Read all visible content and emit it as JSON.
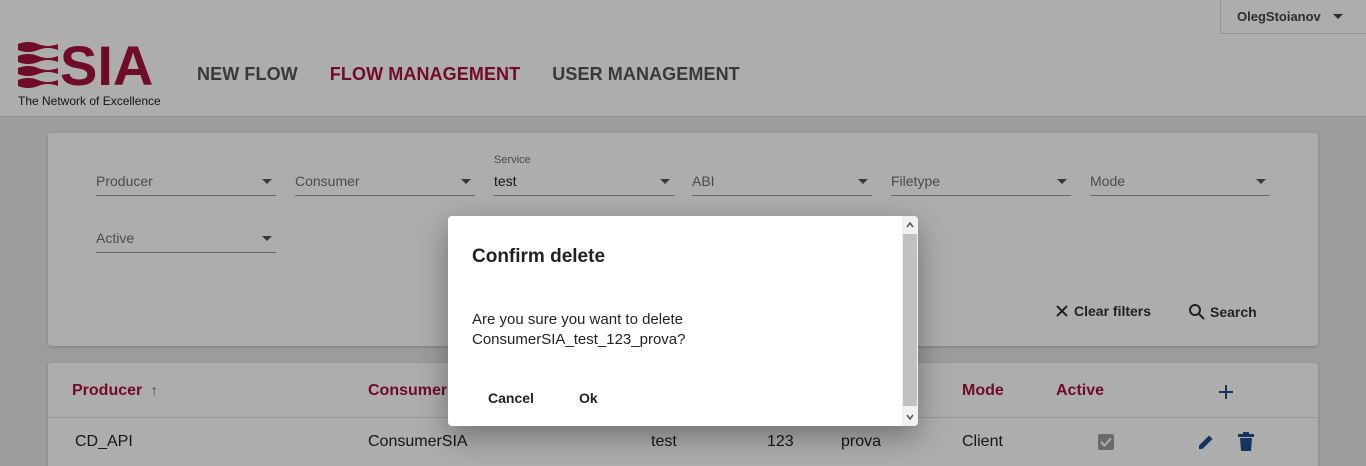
{
  "header": {
    "user_name": "OlegStoianov",
    "logo_text": "SIA",
    "logo_tagline": "The Network of Excellence",
    "nav": [
      "NEW FLOW",
      "FLOW MANAGEMENT",
      "USER MANAGEMENT"
    ],
    "active_nav": "FLOW MANAGEMENT"
  },
  "filters": {
    "producer": "Producer",
    "consumer": "Consumer",
    "service_label": "Service",
    "service_value": "test",
    "abi": "ABI",
    "filetype": "Filetype",
    "mode": "Mode",
    "active": "Active",
    "clear_label": "Clear filters",
    "search_label": "Search"
  },
  "table": {
    "headers": {
      "producer": "Producer",
      "consumer": "Consumer",
      "mode": "Mode",
      "active": "Active"
    },
    "sort_indicator": "↑",
    "row": {
      "producer": "CD_API",
      "consumer": "ConsumerSIA",
      "service": "test",
      "abi": "123",
      "filetype": "prova",
      "mode": "Client",
      "active": true
    }
  },
  "dialog": {
    "title": "Confirm delete",
    "message_line1": "Are you sure you want to delete",
    "message_line2": "ConsumerSIA_test_123_prova?",
    "cancel_label": "Cancel",
    "ok_label": "Ok"
  },
  "colors": {
    "brand": "#a5123a",
    "accent_blue": "#1f4e8c"
  }
}
